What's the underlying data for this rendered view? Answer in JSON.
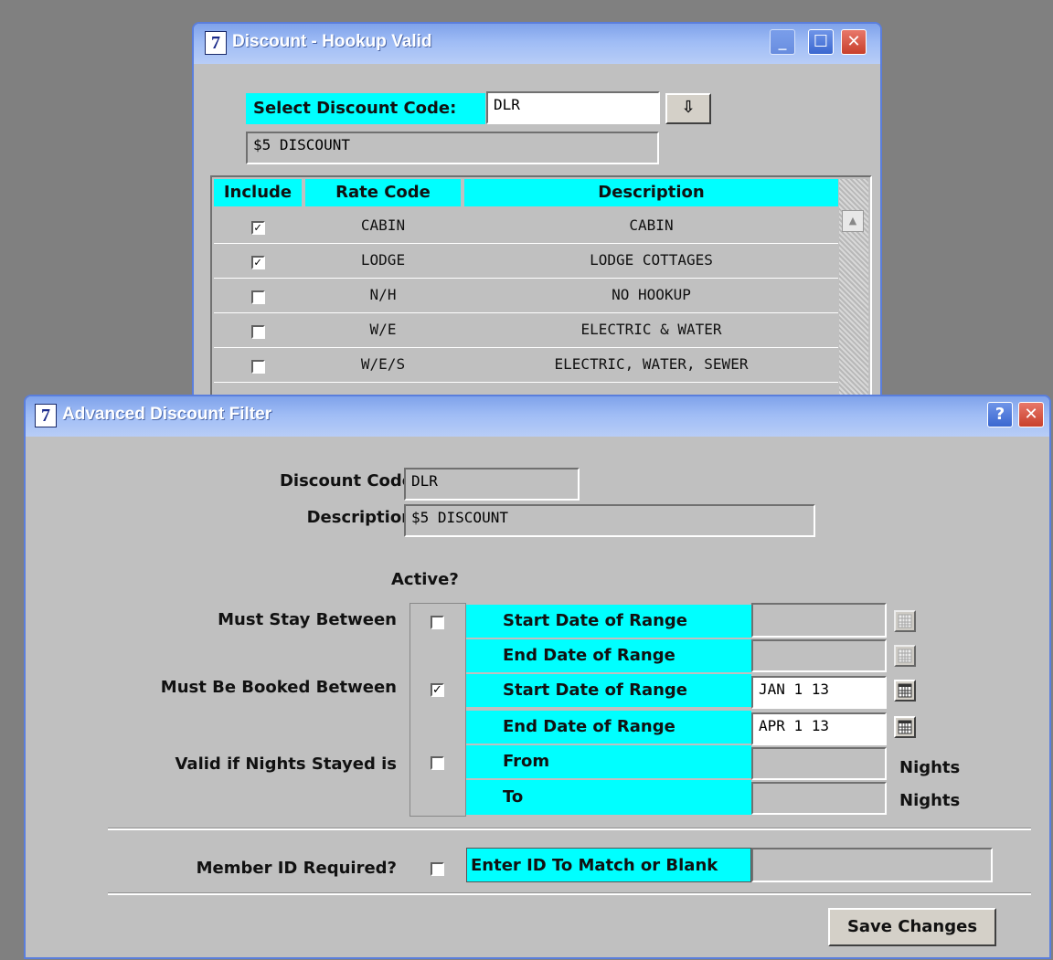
{
  "window1": {
    "title": "Discount - Hookup Valid",
    "select_label": "Select Discount Code:",
    "code_value": "DLR",
    "description_value": "$5 DISCOUNT",
    "columns": [
      "Include",
      "Rate Code",
      "Description"
    ],
    "rows": [
      {
        "checked": true,
        "code": "CABIN",
        "description": "CABIN"
      },
      {
        "checked": true,
        "code": "LODGE",
        "description": "LODGE COTTAGES"
      },
      {
        "checked": false,
        "code": "N/H",
        "description": "NO HOOKUP"
      },
      {
        "checked": false,
        "code": "W/E",
        "description": "ELECTRIC & WATER"
      },
      {
        "checked": false,
        "code": "W/E/S",
        "description": "ELECTRIC, WATER, SEWER"
      }
    ]
  },
  "window2": {
    "title": "Advanced Discount Filter",
    "discount_code_label": "Discount Code",
    "discount_code_value": "DLR",
    "description_label": "Description",
    "description_value": "$5 DISCOUNT",
    "active_header": "Active?",
    "must_stay_label": "Must Stay Between",
    "must_stay_active": false,
    "must_booked_label": "Must Be Booked Between",
    "must_booked_active": true,
    "nights_label": "Valid if Nights Stayed is",
    "nights_active": false,
    "start_range": "Start Date of Range",
    "end_range": "End Date of Range",
    "from_label": "From",
    "to_label": "To",
    "booked_start_value": "JAN 1 13",
    "booked_end_value": "APR 1 13",
    "nights_unit": "Nights",
    "member_label": "Member ID Required?",
    "member_active": false,
    "enter_id_label": "Enter ID To Match or Blank",
    "save_label": "Save Changes"
  }
}
